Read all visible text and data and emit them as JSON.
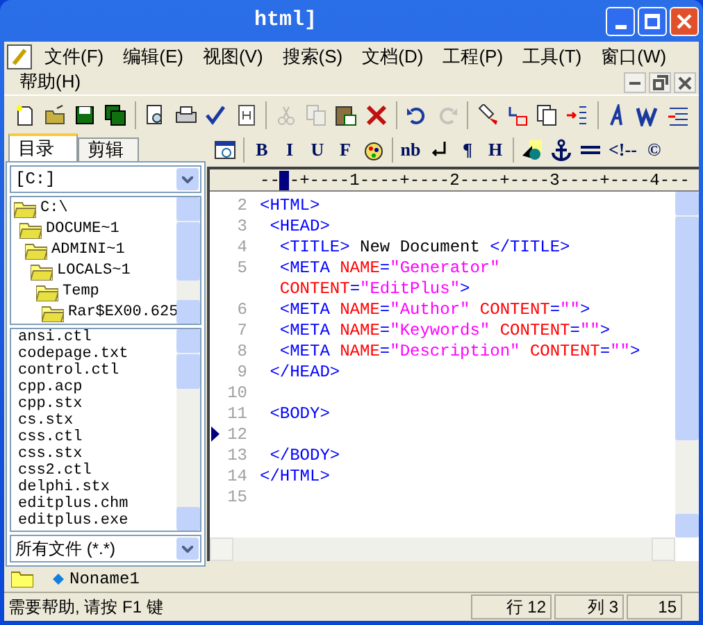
{
  "window": {
    "title": "html]"
  },
  "menu": [
    "文件(F)",
    "编辑(E)",
    "视图(V)",
    "搜索(S)",
    "文档(D)",
    "工程(P)",
    "工具(T)",
    "窗口(W)",
    "帮助(H)"
  ],
  "toolbar": [
    {
      "kind": "new",
      "disabled": false
    },
    {
      "kind": "open",
      "disabled": false
    },
    {
      "kind": "save",
      "disabled": false
    },
    {
      "kind": "saveall",
      "disabled": false
    },
    {
      "kind": "sep"
    },
    {
      "kind": "preview",
      "disabled": false
    },
    {
      "kind": "print",
      "disabled": false
    },
    {
      "kind": "spell",
      "disabled": false
    },
    {
      "kind": "html",
      "disabled": false
    },
    {
      "kind": "sep"
    },
    {
      "kind": "cut",
      "disabled": true
    },
    {
      "kind": "copy",
      "disabled": true
    },
    {
      "kind": "paste",
      "disabled": false
    },
    {
      "kind": "delete",
      "disabled": false
    },
    {
      "kind": "sep"
    },
    {
      "kind": "undo",
      "disabled": false
    },
    {
      "kind": "redo",
      "disabled": true
    },
    {
      "kind": "sep"
    },
    {
      "kind": "find",
      "disabled": false
    },
    {
      "kind": "replace",
      "disabled": false
    },
    {
      "kind": "pages",
      "disabled": false
    },
    {
      "kind": "indent",
      "disabled": false
    },
    {
      "kind": "sep"
    },
    {
      "kind": "font",
      "disabled": false
    },
    {
      "kind": "wrap",
      "disabled": false
    },
    {
      "kind": "outdent",
      "disabled": false
    }
  ],
  "sidebar": {
    "tabs": [
      {
        "label": "目录",
        "selected": true
      },
      {
        "label": "剪辑",
        "selected": false
      }
    ],
    "drive": "[C:]",
    "tree": [
      {
        "name": "C:\\",
        "children": [
          {
            "name": "DOCUME~1",
            "children": [
              {
                "name": "ADMINI~1",
                "children": [
                  {
                    "name": "LOCALS~1",
                    "children": [
                      {
                        "name": "Temp",
                        "children": [
                          {
                            "name": "Rar$EX00.625"
                          }
                        ]
                      }
                    ]
                  }
                ]
              }
            ]
          }
        ]
      }
    ],
    "files": [
      "ansi.ctl",
      "codepage.txt",
      "control.ctl",
      "cpp.acp",
      "cpp.stx",
      "cs.stx",
      "css.ctl",
      "css.stx",
      "css2.ctl",
      "delphi.stx",
      "editplus.chm",
      "editplus.exe"
    ],
    "filter": "所有文件 (*.*)"
  },
  "html_toolbar": [
    {
      "kind": "browser"
    },
    {
      "kind": "sep"
    },
    {
      "kind": "text",
      "label": "B"
    },
    {
      "kind": "text",
      "label": "I"
    },
    {
      "kind": "text",
      "label": "U"
    },
    {
      "kind": "text",
      "label": "F"
    },
    {
      "kind": "palette"
    },
    {
      "kind": "sep"
    },
    {
      "kind": "text",
      "label": "nb"
    },
    {
      "kind": "break"
    },
    {
      "kind": "text",
      "label": "¶"
    },
    {
      "kind": "text",
      "label": "H"
    },
    {
      "kind": "sep"
    },
    {
      "kind": "image"
    },
    {
      "kind": "anchor"
    },
    {
      "kind": "rule"
    },
    {
      "kind": "text",
      "label": "<!--"
    },
    {
      "kind": "text",
      "label": "©"
    }
  ],
  "ruler": {
    "left": "--",
    "right": "-+----1----+----2----+----3----+----4---"
  },
  "code": [
    {
      "number": "2",
      "current": false,
      "tokens": [
        {
          "kind": "tag",
          "text": "<HTML>"
        }
      ]
    },
    {
      "number": "3",
      "current": false,
      "tokens": [
        {
          "kind": "tag",
          "text": " <HEAD>"
        }
      ]
    },
    {
      "number": "4",
      "current": false,
      "tokens": [
        {
          "kind": "tag",
          "text": "  <TITLE>"
        },
        {
          "kind": "text",
          "text": " New Document "
        },
        {
          "kind": "tag",
          "text": "</TITLE>"
        }
      ]
    },
    {
      "number": "5",
      "current": false,
      "tokens": [
        {
          "kind": "tag",
          "text": "  <META "
        },
        {
          "kind": "attr",
          "text": "NAME"
        },
        {
          "kind": "tag",
          "text": "="
        },
        {
          "kind": "string",
          "text": "\"Generator\""
        }
      ]
    },
    {
      "current": false,
      "tokens": [
        {
          "kind": "attr",
          "text": "  CONTENT"
        },
        {
          "kind": "tag",
          "text": "="
        },
        {
          "kind": "string",
          "text": "\"EditPlus\""
        },
        {
          "kind": "tag",
          "text": ">"
        }
      ]
    },
    {
      "number": "6",
      "current": false,
      "tokens": [
        {
          "kind": "tag",
          "text": "  <META "
        },
        {
          "kind": "attr",
          "text": "NAME"
        },
        {
          "kind": "tag",
          "text": "="
        },
        {
          "kind": "string",
          "text": "\"Author\""
        },
        {
          "kind": "attr",
          "text": " CONTENT"
        },
        {
          "kind": "tag",
          "text": "="
        },
        {
          "kind": "string",
          "text": "\"\""
        },
        {
          "kind": "tag",
          "text": ">"
        }
      ]
    },
    {
      "number": "7",
      "current": false,
      "tokens": [
        {
          "kind": "tag",
          "text": "  <META "
        },
        {
          "kind": "attr",
          "text": "NAME"
        },
        {
          "kind": "tag",
          "text": "="
        },
        {
          "kind": "string",
          "text": "\"Keywords\""
        },
        {
          "kind": "attr",
          "text": " CONTENT"
        },
        {
          "kind": "tag",
          "text": "="
        },
        {
          "kind": "string",
          "text": "\"\""
        },
        {
          "kind": "tag",
          "text": ">"
        }
      ]
    },
    {
      "number": "8",
      "current": false,
      "tokens": [
        {
          "kind": "tag",
          "text": "  <META "
        },
        {
          "kind": "attr",
          "text": "NAME"
        },
        {
          "kind": "tag",
          "text": "="
        },
        {
          "kind": "string",
          "text": "\"Description\""
        },
        {
          "kind": "attr",
          "text": " CONTENT"
        },
        {
          "kind": "tag",
          "text": "="
        },
        {
          "kind": "string",
          "text": "\"\""
        },
        {
          "kind": "tag",
          "text": ">"
        }
      ]
    },
    {
      "number": "9",
      "current": false,
      "tokens": [
        {
          "kind": "tag",
          "text": " </HEAD>"
        }
      ]
    },
    {
      "number": "10",
      "current": false
    },
    {
      "number": "11",
      "current": false,
      "tokens": [
        {
          "kind": "tag",
          "text": " <BODY>"
        }
      ]
    },
    {
      "number": "12",
      "current": true
    },
    {
      "number": "13",
      "current": false,
      "tokens": [
        {
          "kind": "tag",
          "text": " </BODY>"
        }
      ]
    },
    {
      "number": "14",
      "current": false,
      "tokens": [
        {
          "kind": "tag",
          "text": "</HTML>"
        }
      ]
    },
    {
      "number": "15",
      "current": false
    }
  ],
  "document_tabs": [
    "Noname1"
  ],
  "status_bar": {
    "message": "需要帮助, 请按 F1 键",
    "line": "行 12",
    "column": "列 3",
    "total": "15"
  }
}
